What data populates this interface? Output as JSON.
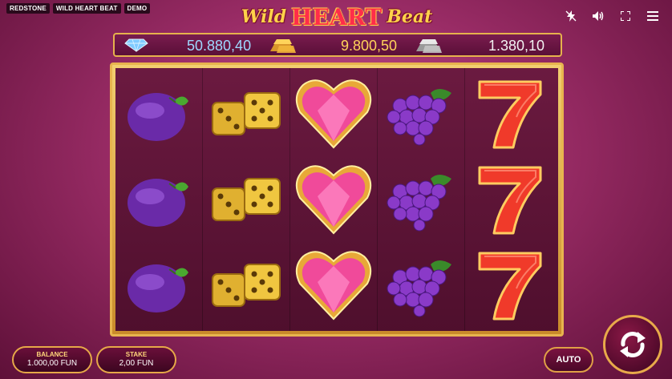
{
  "tags": [
    "REDSTONE",
    "WILD HEART BEAT",
    "DEMO"
  ],
  "logo": {
    "part1": "Wild",
    "part2": "HEART",
    "part3": "Beat"
  },
  "jackpots": [
    {
      "icon": "diamond-icon",
      "value": "50.880,40",
      "color": "#9fd8ff"
    },
    {
      "icon": "gold-bar-icon",
      "value": "9.800,50",
      "color": "#ffd35a"
    },
    {
      "icon": "silver-bar-icon",
      "value": "1.380,10",
      "color": "#f2f2f2"
    }
  ],
  "reels": [
    [
      "plum",
      "plum",
      "plum"
    ],
    [
      "dice",
      "dice",
      "dice"
    ],
    [
      "heart",
      "heart",
      "heart"
    ],
    [
      "grapes",
      "grapes",
      "grapes"
    ],
    [
      "seven",
      "seven",
      "seven"
    ]
  ],
  "balance": {
    "label": "BALANCE",
    "value": "1.000,00 FUN"
  },
  "stake": {
    "label": "STAKE",
    "value": "2,00 FUN"
  },
  "auto": {
    "label": "AUTO"
  },
  "colors": {
    "accent": "#e6b24c",
    "background": "#9a2c66"
  }
}
